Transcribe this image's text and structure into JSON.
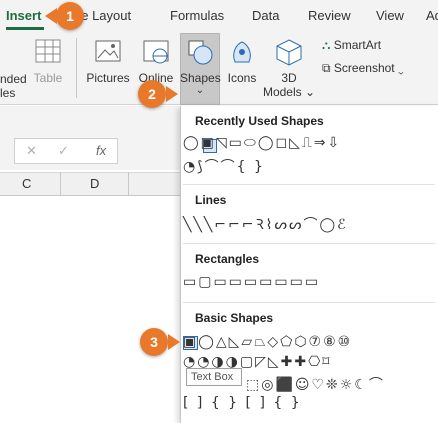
{
  "tabs": [
    {
      "label": "Insert",
      "active": true
    },
    {
      "label": "ge Layout"
    },
    {
      "label": "Formulas"
    },
    {
      "label": "Data"
    },
    {
      "label": "Review"
    },
    {
      "label": "View"
    },
    {
      "label": "Ad"
    }
  ],
  "ribbon": {
    "left_cut_1": "nded",
    "left_cut_2": "les",
    "table": "Table",
    "pictures": "Pictures",
    "online_1": "Online",
    "online_2": "P",
    "shapes": "Shapes",
    "shapes_chevron": "⌄",
    "icons": "Icons",
    "models_1": "3D",
    "models_2": "Models",
    "models_chevron": "⌄",
    "smartart": "SmartArt",
    "screenshot": "Screenshot",
    "screenshot_chevron": "⌄"
  },
  "formula_bar": {
    "cancel": "✕",
    "confirm": "✓",
    "fx": "fx"
  },
  "columns": [
    "C",
    "D"
  ],
  "shapes_menu": {
    "sections": [
      {
        "title": "Recently Used Shapes",
        "rows": [
          "◯▣◹▭⬭◯◻◺⎍⇒⇩",
          "◔⟆⌒⌒{ }"
        ]
      },
      {
        "title": "Lines",
        "rows": [
          "╲╲╲⌐⌐⌐Ꝛ⌇ᔕᔕ⌒◯ℰ"
        ]
      },
      {
        "title": "Rectangles",
        "rows": [
          "▭▢▭▭▭▭▭▭▭"
        ]
      },
      {
        "title": "Basic Shapes",
        "rows": [
          "▣◯△◺▱⏢◇⬠⬡⑦⑧⑩",
          "◔◔◑◑▢◸◺✚✚⎔⌑",
          "⬚◎⬛☺♡❊☼☾⌒",
          "[ ] { } [ ] { }"
        ]
      }
    ],
    "tooltip": "Text Box"
  },
  "steps": [
    "1",
    "2",
    "3"
  ]
}
